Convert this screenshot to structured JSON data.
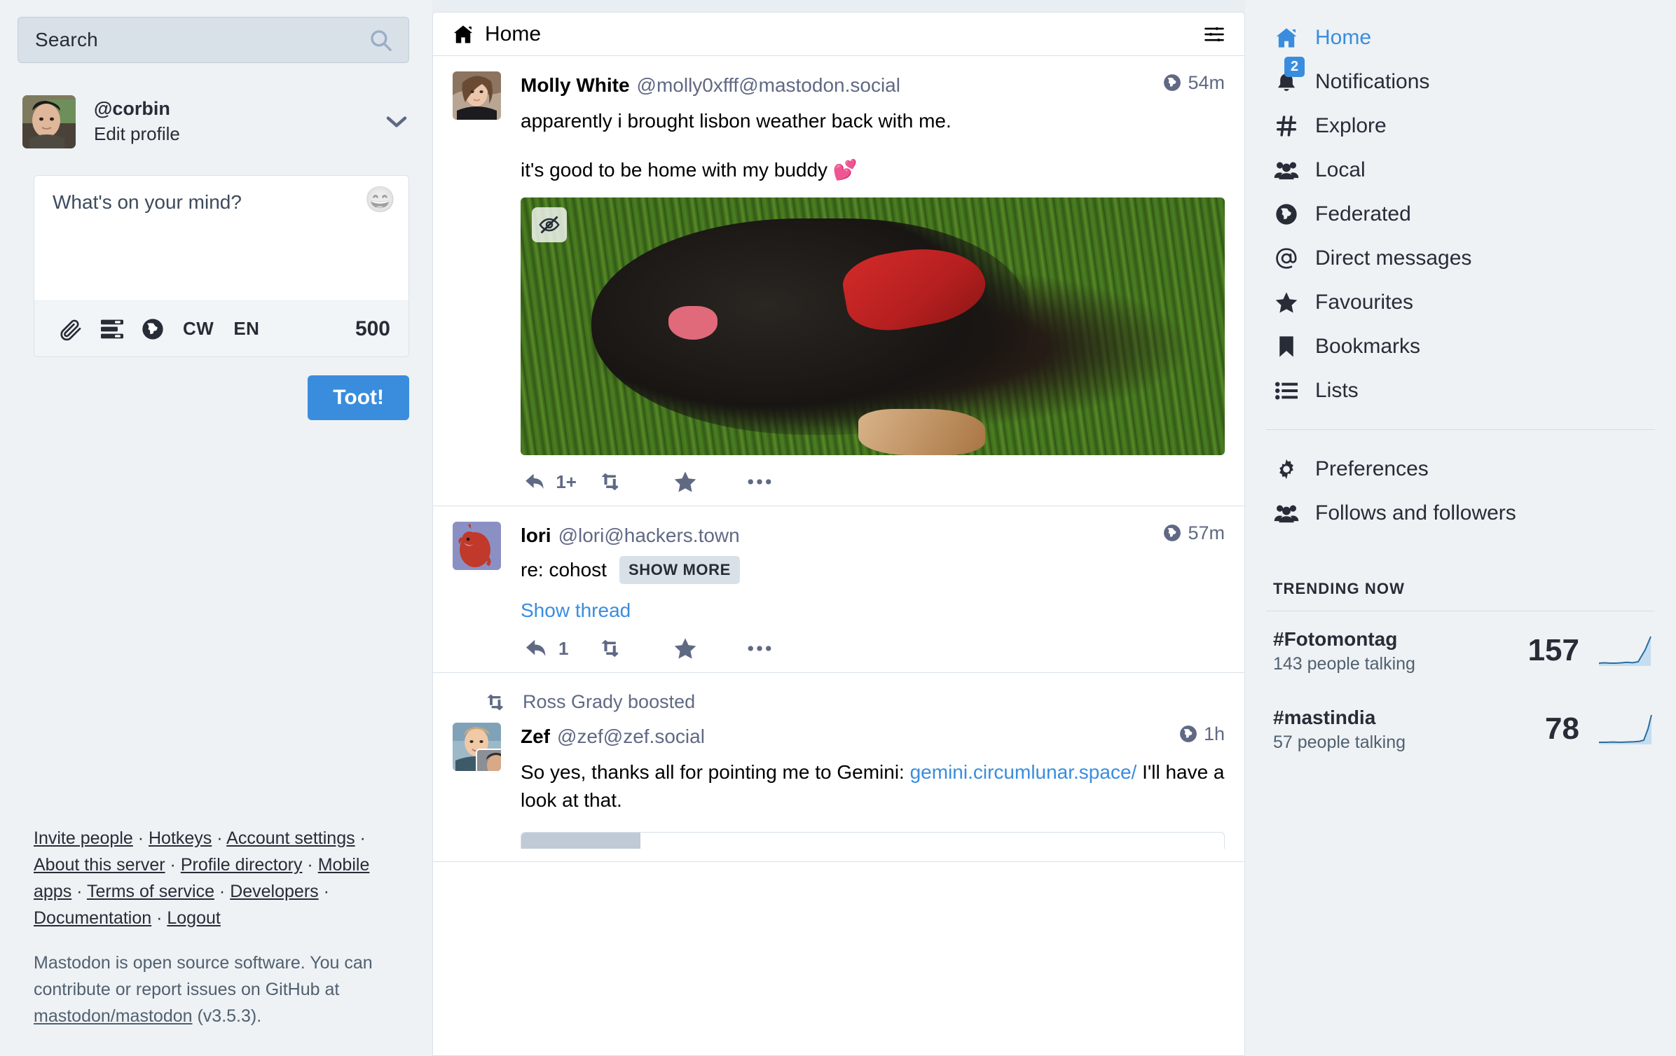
{
  "search": {
    "placeholder": "Search",
    "icon": "search-icon"
  },
  "account": {
    "handle": "@corbin",
    "edit_label": "Edit profile",
    "chevron_icon": "chevron-down-icon"
  },
  "compose": {
    "placeholder": "What's on your mind?",
    "emoji_icon": "emoji-smile-icon",
    "attach_icon": "paperclip-icon",
    "poll_icon": "poll-icon",
    "visibility_icon": "globe-icon",
    "cw_label": "CW",
    "lang_label": "EN",
    "char_count": "500",
    "submit_label": "Toot!"
  },
  "footer": {
    "links": [
      "Invite people",
      "Hotkeys",
      "Account settings",
      "About this server",
      "Profile directory",
      "Mobile apps",
      "Terms of service",
      "Developers",
      "Documentation",
      "Logout"
    ],
    "note_before": "Mastodon is open source software. You can contribute or report issues on GitHub at ",
    "note_link": "mastodon/mastodon",
    "note_after": " (v3.5.3)."
  },
  "column": {
    "title": "Home",
    "home_icon": "home-icon",
    "settings_icon": "sliders-icon"
  },
  "statuses": [
    {
      "display_name": "Molly White",
      "acct": "@molly0xfff@mastodon.social",
      "time": "54m",
      "visibility_icon": "globe-icon",
      "text_1": "apparently i brought lisbon weather back with me.",
      "text_2": "it's good to be home with my buddy 💕",
      "has_media": true,
      "media_hide_icon": "eye-slash-icon",
      "actions": {
        "reply_icon": "reply-icon",
        "reply_count": "1+",
        "boost_icon": "boost-icon",
        "favourite_icon": "star-icon",
        "more_icon": "ellipsis-icon"
      }
    },
    {
      "display_name": "lori",
      "acct": "@lori@hackers.town",
      "time": "57m",
      "visibility_icon": "globe-icon",
      "cw_text": "re: cohost",
      "show_more_label": "SHOW MORE",
      "show_thread_label": "Show thread",
      "actions": {
        "reply_icon": "reply-icon",
        "reply_count": "1",
        "boost_icon": "boost-icon",
        "favourite_icon": "star-icon",
        "more_icon": "ellipsis-icon"
      }
    },
    {
      "boosted_by": "Ross Grady boosted",
      "boost_header_icon": "boost-icon",
      "display_name": "Zef",
      "acct": "@zef@zef.social",
      "time": "1h",
      "visibility_icon": "globe-icon",
      "text_before_link": "So yes, thanks all for pointing me to Gemini: ",
      "link_text": "gemini.circumlunar.space/",
      "text_after_link": "I'll have a look at that."
    }
  ],
  "nav": {
    "items": [
      {
        "label": "Home",
        "icon": "home-icon",
        "active": true
      },
      {
        "label": "Notifications",
        "icon": "bell-icon",
        "badge": "2"
      },
      {
        "label": "Explore",
        "icon": "hash-icon"
      },
      {
        "label": "Local",
        "icon": "users-icon"
      },
      {
        "label": "Federated",
        "icon": "globe-icon"
      },
      {
        "label": "Direct messages",
        "icon": "at-icon"
      },
      {
        "label": "Favourites",
        "icon": "star-icon"
      },
      {
        "label": "Bookmarks",
        "icon": "bookmark-icon"
      },
      {
        "label": "Lists",
        "icon": "list-icon"
      }
    ],
    "secondary": [
      {
        "label": "Preferences",
        "icon": "gear-icon"
      },
      {
        "label": "Follows and followers",
        "icon": "users-icon"
      }
    ]
  },
  "trending": {
    "heading": "TRENDING NOW",
    "items": [
      {
        "tag": "#Fotomontag",
        "subtitle": "143 people talking",
        "count": "157"
      },
      {
        "tag": "#mastindia",
        "subtitle": "57 people talking",
        "count": "78"
      }
    ]
  },
  "chart_data": {
    "type": "line",
    "title": "Trending hashtag sparklines",
    "series": [
      {
        "name": "#Fotomontag",
        "values": [
          4,
          5,
          4,
          4,
          5,
          6,
          5,
          7,
          46,
          95
        ]
      },
      {
        "name": "#mastindia",
        "values": [
          2,
          2,
          3,
          2,
          3,
          3,
          4,
          5,
          38,
          92
        ]
      }
    ],
    "ylim": [
      0,
      100
    ],
    "grid": false,
    "legend": "none"
  },
  "accent_colors": {
    "brand_blue": "#3a8ddd",
    "panel_bg": "#eef2f5",
    "card_bg": "#ffffff",
    "border": "#d9e1e8",
    "muted_text": "#606984",
    "dark_text": "#282c37"
  }
}
